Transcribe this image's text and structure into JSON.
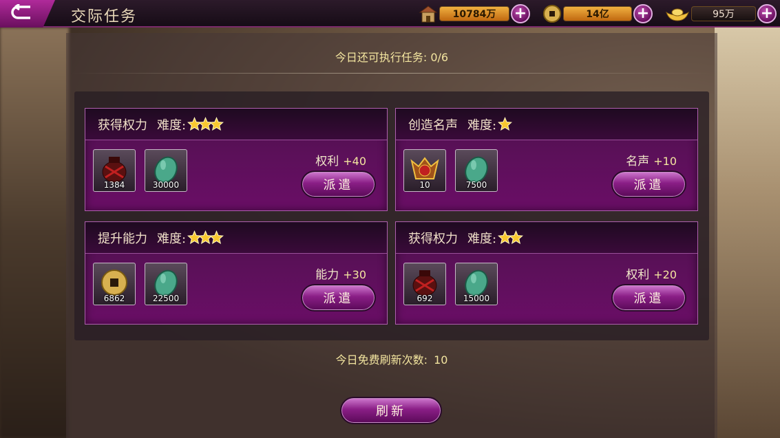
{
  "header": {
    "title": "交际任务",
    "resources": [
      {
        "icon": "granary-icon",
        "value": "10784万"
      },
      {
        "icon": "copper-coin-icon",
        "value": "14亿"
      },
      {
        "icon": "gold-ingot-icon",
        "value": "95万"
      }
    ]
  },
  "remaining_label": "今日还可执行任务: ",
  "remaining_value": "0/6",
  "difficulty_label": "难度:",
  "tasks": [
    {
      "name": "获得权力",
      "stars": 3,
      "items": [
        {
          "icon": "wine-jar-icon",
          "count": "1384"
        },
        {
          "icon": "jade-stone-icon",
          "count": "30000"
        }
      ],
      "reward_name": "权利",
      "reward_value": "+40",
      "button": "派遣"
    },
    {
      "name": "创造名声",
      "stars": 1,
      "items": [
        {
          "icon": "merit-badge-icon",
          "count": "10"
        },
        {
          "icon": "jade-stone-icon",
          "count": "7500"
        }
      ],
      "reward_name": "名声",
      "reward_value": "+10",
      "button": "派遣"
    },
    {
      "name": "提升能力",
      "stars": 3,
      "items": [
        {
          "icon": "copper-coin-icon",
          "count": "6862"
        },
        {
          "icon": "jade-stone-icon",
          "count": "22500"
        }
      ],
      "reward_name": "能力",
      "reward_value": "+30",
      "button": "派遣"
    },
    {
      "name": "获得权力",
      "stars": 2,
      "items": [
        {
          "icon": "wine-jar-icon",
          "count": "692"
        },
        {
          "icon": "jade-stone-icon",
          "count": "15000"
        }
      ],
      "reward_name": "权利",
      "reward_value": "+20",
      "button": "派遣"
    }
  ],
  "free_refresh_label": "今日免费刷新次数: ",
  "free_refresh_value": "10",
  "refresh_button": "刷新",
  "colors": {
    "accent": "#8a1e86",
    "highlight": "#f4e6a0",
    "star": "#f8c830"
  }
}
